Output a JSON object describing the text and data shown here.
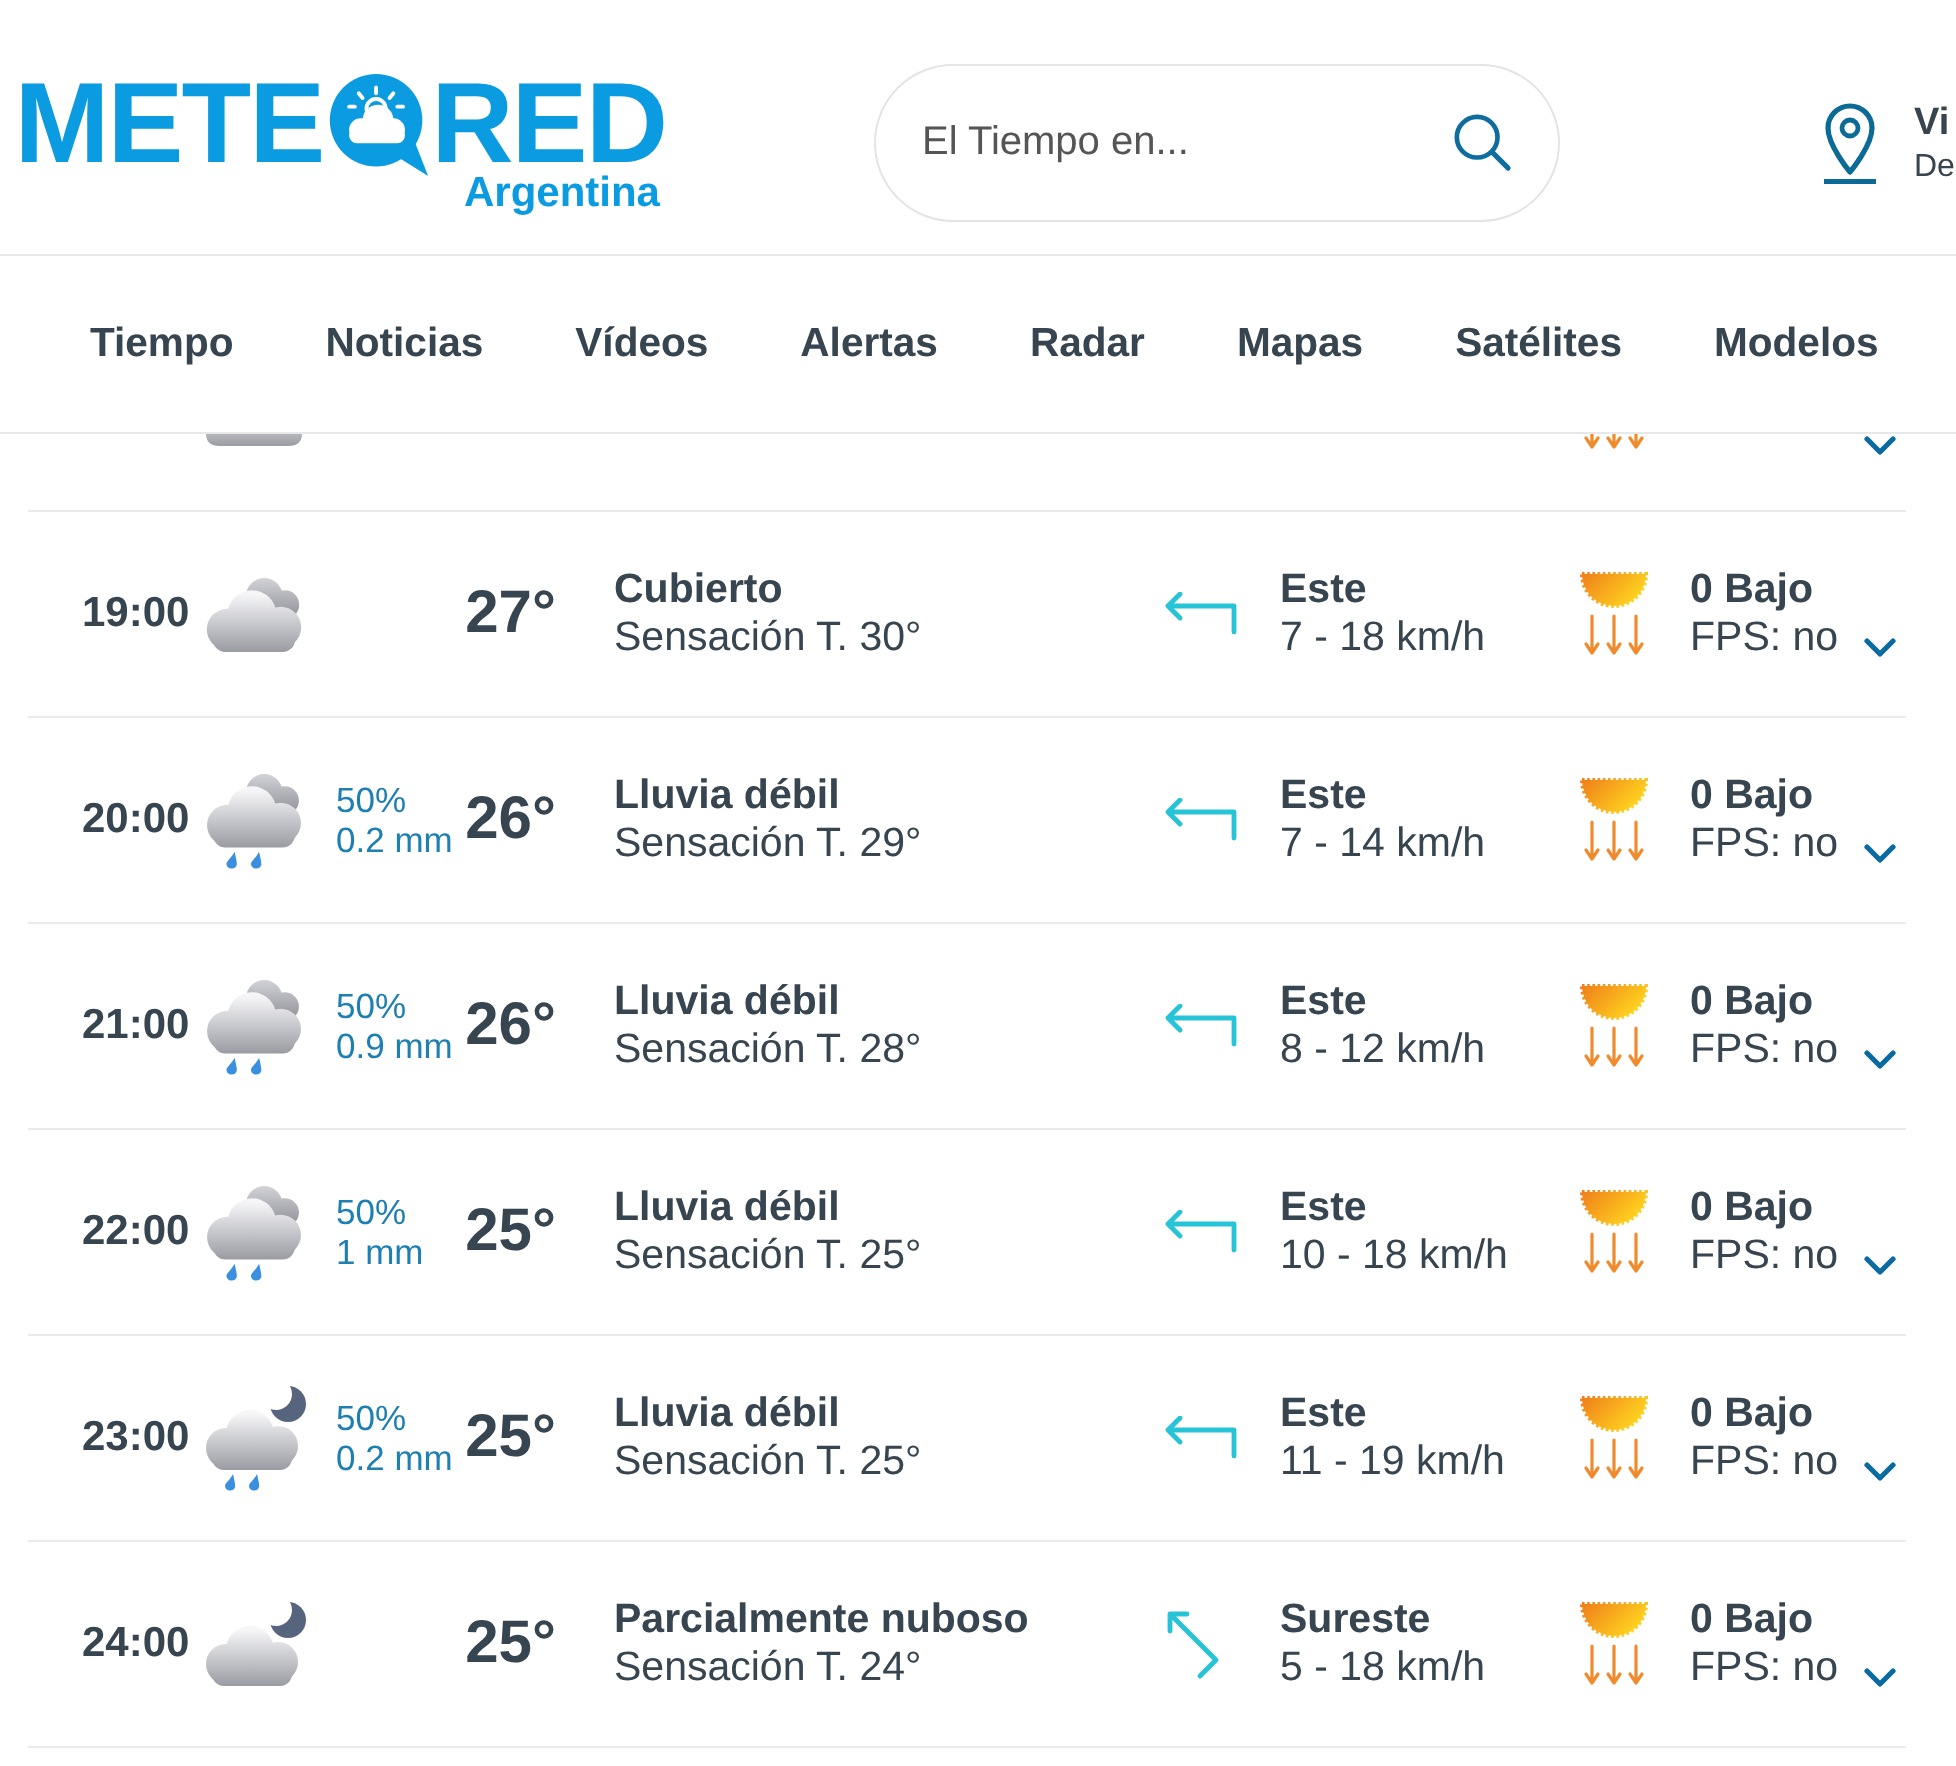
{
  "header": {
    "logo": {
      "text_before": "METE",
      "text_after": "RED",
      "region": "Argentina"
    },
    "search": {
      "placeholder": "El Tiempo en..."
    },
    "location": {
      "name": "Vi",
      "detail": "De"
    }
  },
  "nav": {
    "items": [
      "Tiempo",
      "Noticias",
      "Vídeos",
      "Alertas",
      "Radar",
      "Mapas",
      "Satélites",
      "Modelos"
    ]
  },
  "hourly": {
    "partial_row": {
      "expanded": false
    },
    "rows": [
      {
        "time": "19:00",
        "kind": "cloudy",
        "temperature": "27°",
        "condition": "Cubierto",
        "feels_like": "Sensación T. 30°",
        "wind": {
          "kind": "left",
          "direction": "Este",
          "speed": "7 - 18 km/h"
        },
        "uv": "0 Bajo",
        "fps": "FPS: no",
        "expanded": false
      },
      {
        "time": "20:00",
        "kind": "rain",
        "precipitation": {
          "probability": "50%",
          "amount": "0.2 mm"
        },
        "temperature": "26°",
        "condition": "Lluvia débil",
        "feels_like": "Sensación T. 29°",
        "wind": {
          "kind": "left",
          "direction": "Este",
          "speed": "7 - 14 km/h"
        },
        "uv": "0 Bajo",
        "fps": "FPS: no",
        "expanded": false
      },
      {
        "time": "21:00",
        "kind": "rain",
        "precipitation": {
          "probability": "50%",
          "amount": "0.9 mm"
        },
        "temperature": "26°",
        "condition": "Lluvia débil",
        "feels_like": "Sensación T. 28°",
        "wind": {
          "kind": "left",
          "direction": "Este",
          "speed": "8 - 12 km/h"
        },
        "uv": "0 Bajo",
        "fps": "FPS: no",
        "expanded": false
      },
      {
        "time": "22:00",
        "kind": "rain",
        "precipitation": {
          "probability": "50%",
          "amount": "1 mm"
        },
        "temperature": "25°",
        "condition": "Lluvia débil",
        "feels_like": "Sensación T. 25°",
        "wind": {
          "kind": "left",
          "direction": "Este",
          "speed": "10 - 18 km/h"
        },
        "uv": "0 Bajo",
        "fps": "FPS: no",
        "expanded": false
      },
      {
        "time": "23:00",
        "kind": "night-rain",
        "precipitation": {
          "probability": "50%",
          "amount": "0.2 mm"
        },
        "temperature": "25°",
        "condition": "Lluvia débil",
        "feels_like": "Sensación T. 25°",
        "wind": {
          "kind": "left",
          "direction": "Este",
          "speed": "11 - 19 km/h"
        },
        "uv": "0 Bajo",
        "fps": "FPS: no",
        "expanded": false
      },
      {
        "time": "24:00",
        "kind": "night-cloudy",
        "temperature": "25°",
        "condition": "Parcialmente nuboso",
        "feels_like": "Sensación T. 24°",
        "wind": {
          "kind": "up-left",
          "direction": "Sureste",
          "speed": "5 - 18 km/h"
        },
        "uv": "0 Bajo",
        "fps": "FPS: no",
        "expanded": false
      }
    ]
  }
}
